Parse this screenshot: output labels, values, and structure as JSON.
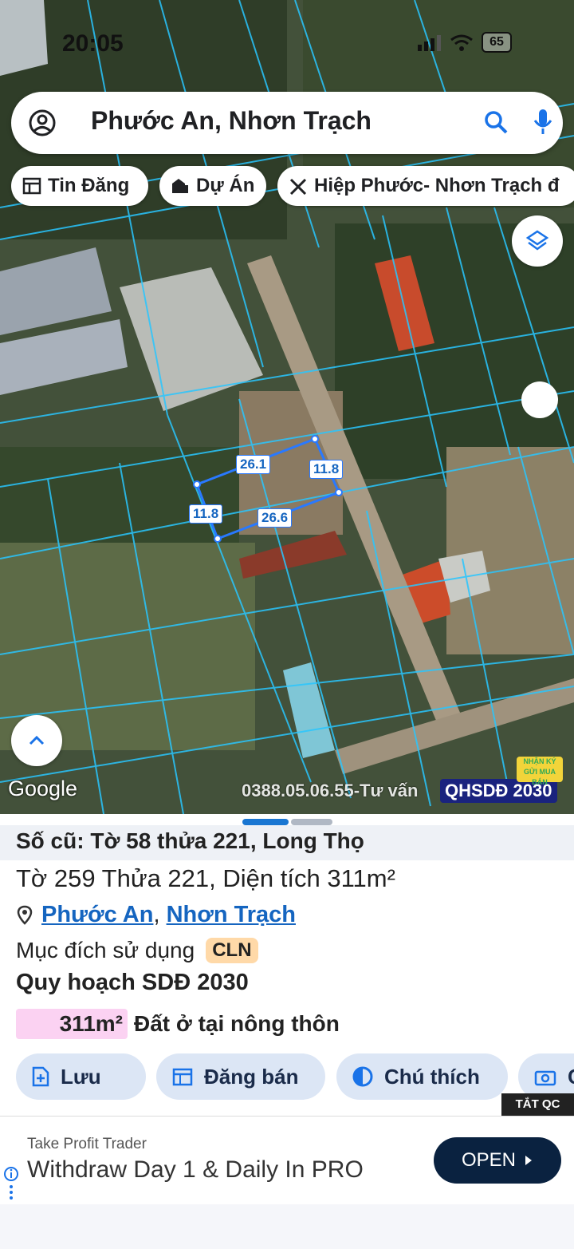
{
  "status": {
    "time": "20:05",
    "battery": "65"
  },
  "search": {
    "query": "Phước An, Nhơn Trạch"
  },
  "chips": [
    {
      "label": "Tin Đăng",
      "icon": "listing-icon"
    },
    {
      "label": "Dự Án",
      "icon": "building-icon"
    },
    {
      "label": "Hiệp Phước- Nhơn Trạch đ",
      "icon": "tools-icon"
    }
  ],
  "map": {
    "attribution": "Google",
    "watermark": "0388.05.06.55-Tư vấn",
    "plan_badge": "QHSDĐ 2030",
    "logo_text": "NHẬN KÝ GỬI MUA BÁN",
    "dimensions": {
      "top": "26.1",
      "right": "11.8",
      "left": "11.8",
      "bottom": "26.6"
    },
    "plot_color": "#2979ff",
    "parcel_color": "#29c6ff"
  },
  "parcel": {
    "old_id": "Số cũ: Tờ 58 thửa 221, Long Thọ",
    "summary": "Tờ 259 Thửa 221, Diện tích 311m²",
    "ward": "Phước An",
    "separator": ",",
    "district": "Nhơn Trạch",
    "purpose_label": "Mục đích sử dụng",
    "purpose_code": "CLN",
    "plan_title": "Quy hoạch SDĐ 2030",
    "plan_area": "311m²",
    "plan_type": "Đất ở tại nông thôn"
  },
  "actions": [
    {
      "label": "Lưu",
      "icon": "save-icon"
    },
    {
      "label": "Đăng bán",
      "icon": "calendar-icon"
    },
    {
      "label": "Chú thích",
      "icon": "legend-icon"
    },
    {
      "label": "C",
      "icon": "camera-icon"
    }
  ],
  "ad": {
    "hide_label": "TẮT QC",
    "sponsor": "Take Profit Trader",
    "headline": "Withdraw Day 1 & Daily In PRO",
    "cta": "OPEN"
  }
}
